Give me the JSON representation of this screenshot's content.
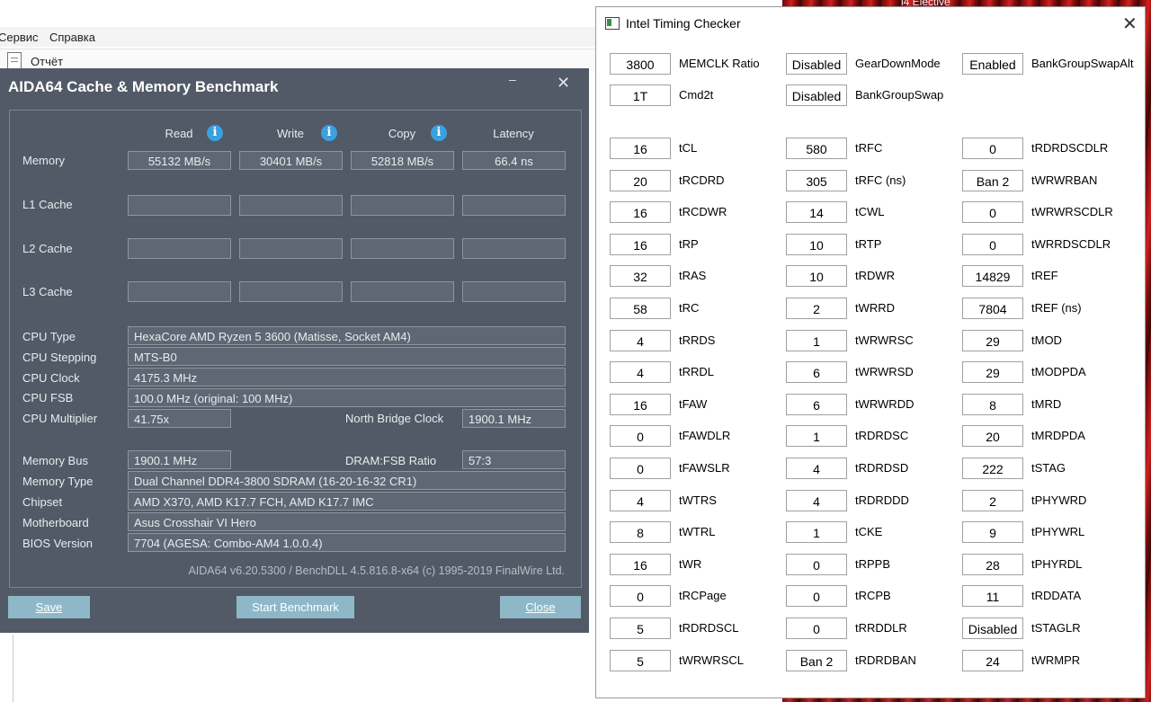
{
  "background_app": {
    "menu": [
      "Сервис",
      "Справка"
    ],
    "toolbar_item": "Отчёт",
    "red_text": "i4 Elective"
  },
  "aida": {
    "title": "AIDA64 Cache & Memory Benchmark",
    "minimize": "–",
    "close_x": "✕",
    "headers": [
      "Read",
      "Write",
      "Copy",
      "Latency"
    ],
    "info_glyph": "i",
    "rows": [
      {
        "label": "Memory",
        "values": [
          "55132 MB/s",
          "30401 MB/s",
          "52818 MB/s",
          "66.4 ns"
        ]
      },
      {
        "label": "L1 Cache",
        "values": [
          "",
          "",
          "",
          ""
        ]
      },
      {
        "label": "L2 Cache",
        "values": [
          "",
          "",
          "",
          ""
        ]
      },
      {
        "label": "L3 Cache",
        "values": [
          "",
          "",
          "",
          ""
        ]
      }
    ],
    "cpu": {
      "type_label": "CPU Type",
      "type": "HexaCore AMD Ryzen 5 3600  (Matisse, Socket AM4)",
      "stepping_label": "CPU Stepping",
      "stepping": "MTS-B0",
      "clock_label": "CPU Clock",
      "clock": "4175.3 MHz",
      "fsb_label": "CPU FSB",
      "fsb": "100.0 MHz  (original: 100 MHz)",
      "mult_label": "CPU Multiplier",
      "mult": "41.75x",
      "nb_label": "North Bridge Clock",
      "nb": "1900.1 MHz"
    },
    "mem": {
      "bus_label": "Memory Bus",
      "bus": "1900.1 MHz",
      "ratio_label": "DRAM:FSB Ratio",
      "ratio": "57:3",
      "type_label": "Memory Type",
      "type": "Dual Channel DDR4-3800 SDRAM  (16-20-16-32 CR1)",
      "chipset_label": "Chipset",
      "chipset": "AMD X370, AMD K17.7 FCH, AMD K17.7 IMC",
      "mb_label": "Motherboard",
      "mb": "Asus Crosshair VI Hero",
      "bios_label": "BIOS Version",
      "bios": "7704  (AGESA: Combo-AM4 1.0.0.4)"
    },
    "footer": "AIDA64 v6.20.5300 / BenchDLL 4.5.816.8-x64  (c) 1995-2019 FinalWire Ltd.",
    "buttons": {
      "save": "Save",
      "start": "Start Benchmark",
      "close": "Close"
    }
  },
  "itc": {
    "title": "Intel Timing Checker",
    "close_x": "✕",
    "top": [
      [
        {
          "v": "3800",
          "l": "MEMCLK Ratio"
        },
        {
          "v": "Disabled",
          "l": "GearDownMode"
        },
        {
          "v": "Enabled",
          "l": "BankGroupSwapAlt"
        }
      ],
      [
        {
          "v": "1T",
          "l": "Cmd2t"
        },
        {
          "v": "Disabled",
          "l": "BankGroupSwap"
        }
      ]
    ],
    "grid": [
      [
        {
          "v": "16",
          "l": "tCL"
        },
        {
          "v": "580",
          "l": "tRFC"
        },
        {
          "v": "0",
          "l": "tRDRDSCDLR"
        }
      ],
      [
        {
          "v": "20",
          "l": "tRCDRD"
        },
        {
          "v": "305",
          "l": "tRFC (ns)"
        },
        {
          "v": "Ban 2",
          "l": "tWRWRBAN"
        }
      ],
      [
        {
          "v": "16",
          "l": "tRCDWR"
        },
        {
          "v": "14",
          "l": "tCWL"
        },
        {
          "v": "0",
          "l": "tWRWRSCDLR"
        }
      ],
      [
        {
          "v": "16",
          "l": "tRP"
        },
        {
          "v": "10",
          "l": "tRTP"
        },
        {
          "v": "0",
          "l": "tWRRDSCDLR"
        }
      ],
      [
        {
          "v": "32",
          "l": "tRAS"
        },
        {
          "v": "10",
          "l": "tRDWR"
        },
        {
          "v": "14829",
          "l": "tREF"
        }
      ],
      [
        {
          "v": "58",
          "l": "tRC"
        },
        {
          "v": "2",
          "l": "tWRRD"
        },
        {
          "v": "7804",
          "l": "tREF (ns)"
        }
      ],
      [
        {
          "v": "4",
          "l": "tRRDS"
        },
        {
          "v": "1",
          "l": "tWRWRSC"
        },
        {
          "v": "29",
          "l": "tMOD"
        }
      ],
      [
        {
          "v": "4",
          "l": "tRRDL"
        },
        {
          "v": "6",
          "l": "tWRWRSD"
        },
        {
          "v": "29",
          "l": "tMODPDA"
        }
      ],
      [
        {
          "v": "16",
          "l": "tFAW"
        },
        {
          "v": "6",
          "l": "tWRWRDD"
        },
        {
          "v": "8",
          "l": "tMRD"
        }
      ],
      [
        {
          "v": "0",
          "l": "tFAWDLR"
        },
        {
          "v": "1",
          "l": "tRDRDSC"
        },
        {
          "v": "20",
          "l": "tMRDPDA"
        }
      ],
      [
        {
          "v": "0",
          "l": "tFAWSLR"
        },
        {
          "v": "4",
          "l": "tRDRDSD"
        },
        {
          "v": "222",
          "l": "tSTAG"
        }
      ],
      [
        {
          "v": "4",
          "l": "tWTRS"
        },
        {
          "v": "4",
          "l": "tRDRDDD"
        },
        {
          "v": "2",
          "l": "tPHYWRD"
        }
      ],
      [
        {
          "v": "8",
          "l": "tWTRL"
        },
        {
          "v": "1",
          "l": "tCKE"
        },
        {
          "v": "9",
          "l": "tPHYWRL"
        }
      ],
      [
        {
          "v": "16",
          "l": "tWR"
        },
        {
          "v": "0",
          "l": "tRPPB"
        },
        {
          "v": "28",
          "l": "tPHYRDL"
        }
      ],
      [
        {
          "v": "0",
          "l": "tRCPage"
        },
        {
          "v": "0",
          "l": "tRCPB"
        },
        {
          "v": "11",
          "l": "tRDDATA"
        }
      ],
      [
        {
          "v": "5",
          "l": "tRDRDSCL"
        },
        {
          "v": "0",
          "l": "tRRDDLR"
        },
        {
          "v": "Disabled",
          "l": "tSTAGLR"
        }
      ],
      [
        {
          "v": "5",
          "l": "tWRWRSCL"
        },
        {
          "v": "Ban 2",
          "l": "tRDRDBAN"
        },
        {
          "v": "24",
          "l": "tWRMPR"
        }
      ]
    ]
  }
}
